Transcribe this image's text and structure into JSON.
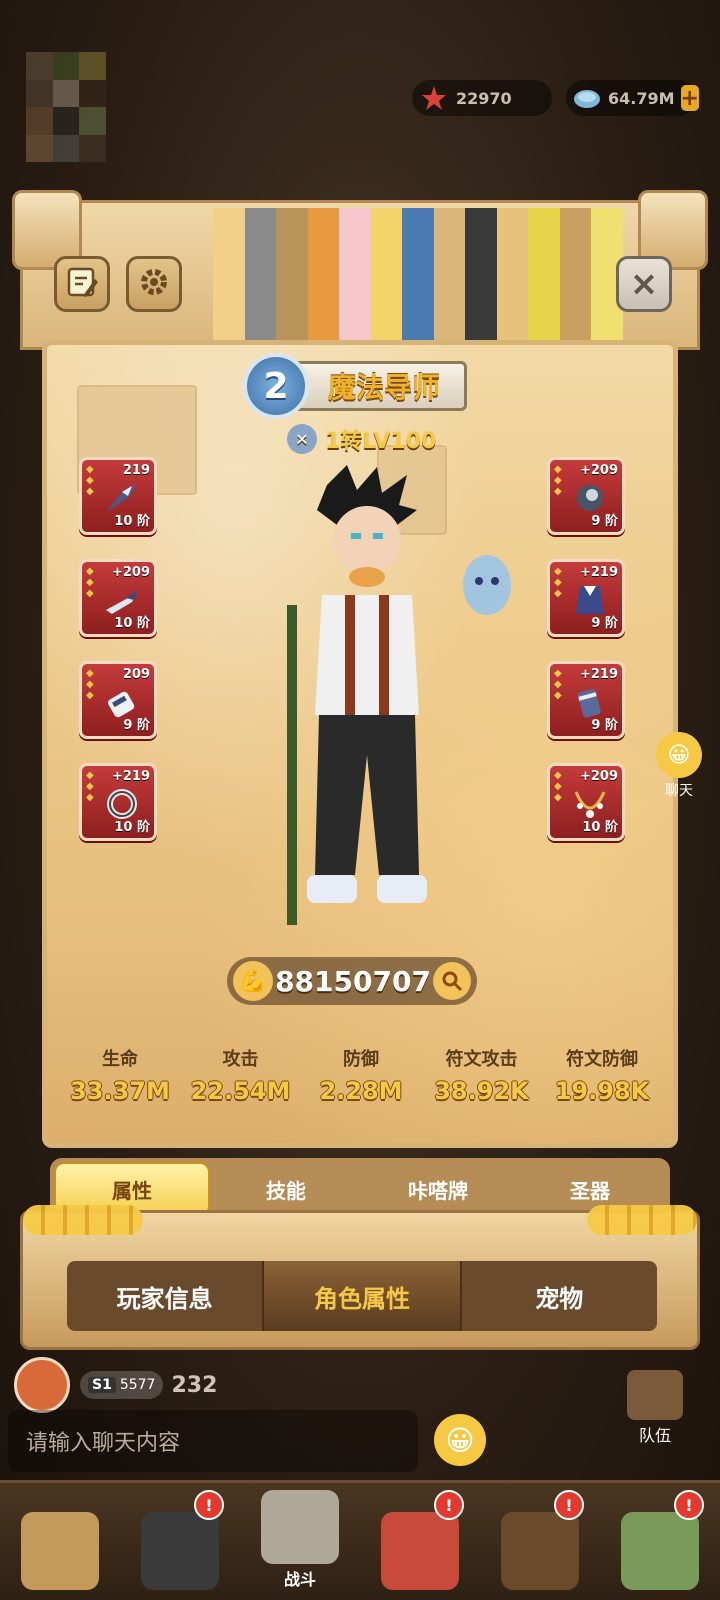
{
  "currencies": {
    "star_value": "22970",
    "gem_value": "64.79M",
    "plus_label": "+"
  },
  "panel": {
    "close_label": "×",
    "class_badge": "2",
    "class_name": "魔法导师",
    "level_text": "1转LV100"
  },
  "equipment_left": [
    {
      "plus": "219",
      "tier": "10 阶",
      "icon": "shark-weapon-icon"
    },
    {
      "plus": "+209",
      "tier": "10 阶",
      "icon": "bird-weapon-icon"
    },
    {
      "plus": "209",
      "tier": "9 阶",
      "icon": "gauntlet-icon"
    },
    {
      "plus": "+219",
      "tier": "10 阶",
      "icon": "ring-icon"
    }
  ],
  "equipment_right": [
    {
      "plus": "+209",
      "tier": "9 阶",
      "icon": "orb-helmet-icon"
    },
    {
      "plus": "+219",
      "tier": "9 阶",
      "icon": "cape-armor-icon"
    },
    {
      "plus": "+219",
      "tier": "9 阶",
      "icon": "bracer-icon"
    },
    {
      "plus": "+209",
      "tier": "10 阶",
      "icon": "necklace-icon"
    }
  ],
  "power": {
    "value": "88150707"
  },
  "stats": [
    {
      "label": "生命",
      "value": "33.37M"
    },
    {
      "label": "攻击",
      "value": "22.54M"
    },
    {
      "label": "防御",
      "value": "2.28M"
    },
    {
      "label": "符文攻击",
      "value": "38.92K"
    },
    {
      "label": "符文防御",
      "value": "19.98K"
    }
  ],
  "tabs": [
    {
      "label": "属性",
      "active": true
    },
    {
      "label": "技能",
      "active": false
    },
    {
      "label": "咔嗒牌",
      "active": false
    },
    {
      "label": "圣器",
      "active": false
    }
  ],
  "bottom_tabs": [
    {
      "label": "玩家信息",
      "active": false
    },
    {
      "label": "角色属性",
      "active": true
    },
    {
      "label": "宠物",
      "active": false
    }
  ],
  "side": {
    "chat_label": "聊天",
    "team_label": "队伍"
  },
  "player": {
    "season": "S1",
    "season_score": "5577",
    "number": "232"
  },
  "chat": {
    "placeholder": "请输入聊天内容"
  },
  "nav": {
    "battle_label": "战斗",
    "badge": "!"
  },
  "colors": {
    "accent_gold": "#f6c945",
    "equip_red": "#c43b3b",
    "panel_sand": "#ecc98a"
  }
}
